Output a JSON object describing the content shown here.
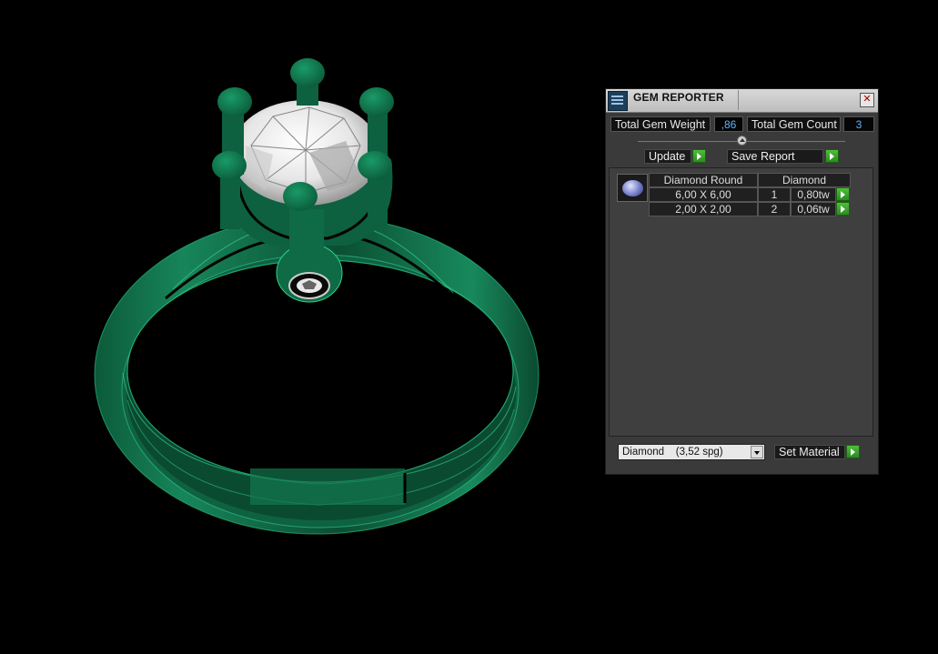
{
  "window": {
    "title": "GEM REPORTER",
    "close_glyph": "✕"
  },
  "totals": {
    "weight_label": "Total Gem Weight",
    "weight_value": ",86",
    "count_label": "Total Gem Count",
    "count_value": "3"
  },
  "actions": {
    "update_label": "Update",
    "save_report_label": "Save Report"
  },
  "gem_table": {
    "headers": [
      "Diamond Round",
      "Diamond"
    ],
    "rows": [
      {
        "size": "6,00 X 6,00",
        "count": "1",
        "weight": "0,80tw"
      },
      {
        "size": "2,00 X 2,00",
        "count": "2",
        "weight": "0,06tw"
      }
    ]
  },
  "material": {
    "selected": "Diamond    (3,52 spg)",
    "set_label": "Set Material"
  },
  "icons": [
    "gem-reporter-icon",
    "close-icon",
    "slider-knob-icon",
    "go-arrow-icon",
    "round-gem-icon",
    "chevron-down-icon"
  ],
  "colors": {
    "ring_green": "#0f6b45",
    "accent_value": "#5ab4ff",
    "go_green": "#3aa52b"
  }
}
